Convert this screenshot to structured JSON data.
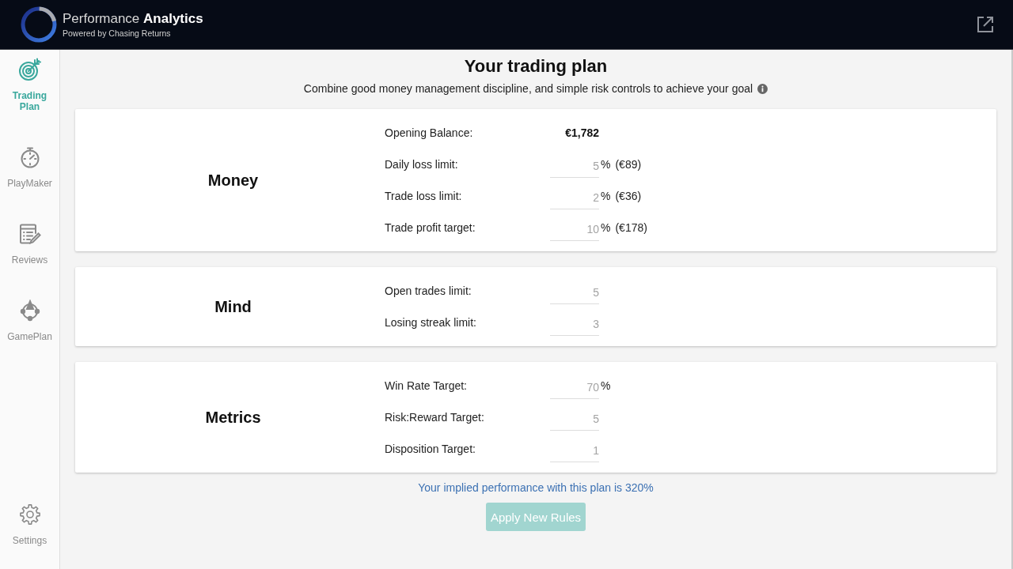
{
  "header": {
    "title": "Performance **Analytics**",
    "subtitle": "Powered by Chasing Returns"
  },
  "sidebar": {
    "items": [
      {
        "label": "Trading Plan",
        "selected": true
      },
      {
        "label": "PlayMaker",
        "selected": false
      },
      {
        "label": "Reviews",
        "selected": false
      },
      {
        "label": "GamePlan",
        "selected": false
      }
    ],
    "footer_items": [
      {
        "label": "Settings",
        "selected": false
      }
    ]
  },
  "page": {
    "title": "Your trading plan",
    "subtitle": "Combine good money management discipline, and simple risk controls to achieve your goal"
  },
  "sections": [
    {
      "title": "Money",
      "rows": [
        {
          "kind": "static",
          "label": "Opening Balance:",
          "value": "€1,782"
        },
        {
          "kind": "input",
          "label": "Daily loss limit:",
          "placeholder": "5",
          "unit": "%",
          "amount": "(€89)"
        },
        {
          "kind": "input",
          "label": "Trade loss limit:",
          "placeholder": "2",
          "unit": "%",
          "amount": "(€36)"
        },
        {
          "kind": "input",
          "label": "Trade profit target:",
          "placeholder": "10",
          "unit": "%",
          "amount": "(€178)"
        }
      ]
    },
    {
      "title": "Mind",
      "rows": [
        {
          "kind": "input",
          "label": "Open trades limit:",
          "placeholder": "5"
        },
        {
          "kind": "input",
          "label": "Losing streak limit:",
          "placeholder": "3"
        }
      ]
    },
    {
      "title": "Metrics",
      "rows": [
        {
          "kind": "input",
          "label": "Win Rate Target:",
          "placeholder": "70",
          "unit": "%"
        },
        {
          "kind": "input",
          "label": "Risk:Reward Target:",
          "placeholder": "5"
        },
        {
          "kind": "input",
          "label": "Disposition Target:",
          "placeholder": "1"
        }
      ]
    }
  ],
  "summary": "Your implied performance with this plan is 320%",
  "apply_button": {
    "label": "Apply New Rules",
    "disabled": true
  }
}
